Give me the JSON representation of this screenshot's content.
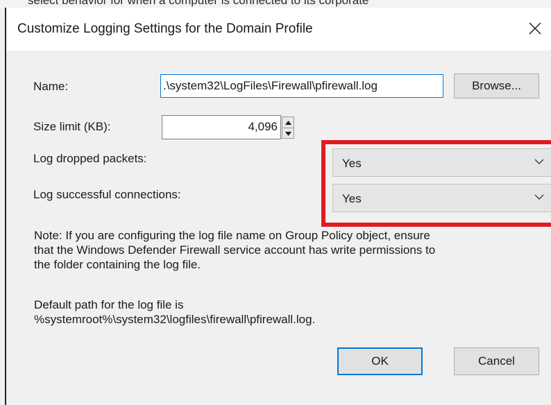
{
  "background_window": {
    "text": "select behavior for when a computer is connected to its corporate"
  },
  "dialog": {
    "title": "Customize Logging Settings for the Domain Profile",
    "close_symbol": "close-icon"
  },
  "name": {
    "label": "Name:",
    "value": ".\\system32\\LogFiles\\Firewall\\pfirewall.log",
    "browse_label": "Browse..."
  },
  "size_limit": {
    "label": "Size limit (KB):",
    "value": "4,096"
  },
  "log_dropped": {
    "label": "Log dropped packets:",
    "selected": "Yes"
  },
  "log_successful": {
    "label": "Log successful connections:",
    "selected": "Yes"
  },
  "note": {
    "line1": "Note: If you are configuring the log file name on Group Policy object, ensure",
    "line2": "that the Windows Defender Firewall service account has write permissions to",
    "line3": "the folder containing the log file."
  },
  "default_path": {
    "line1": "Default path for the log file is",
    "line2": "%systemroot%\\system32\\logfiles\\firewall\\pfirewall.log."
  },
  "buttons": {
    "ok": "OK",
    "cancel": "Cancel"
  },
  "colors": {
    "highlight": "#e11b22",
    "focus_border": "#0078d7"
  }
}
